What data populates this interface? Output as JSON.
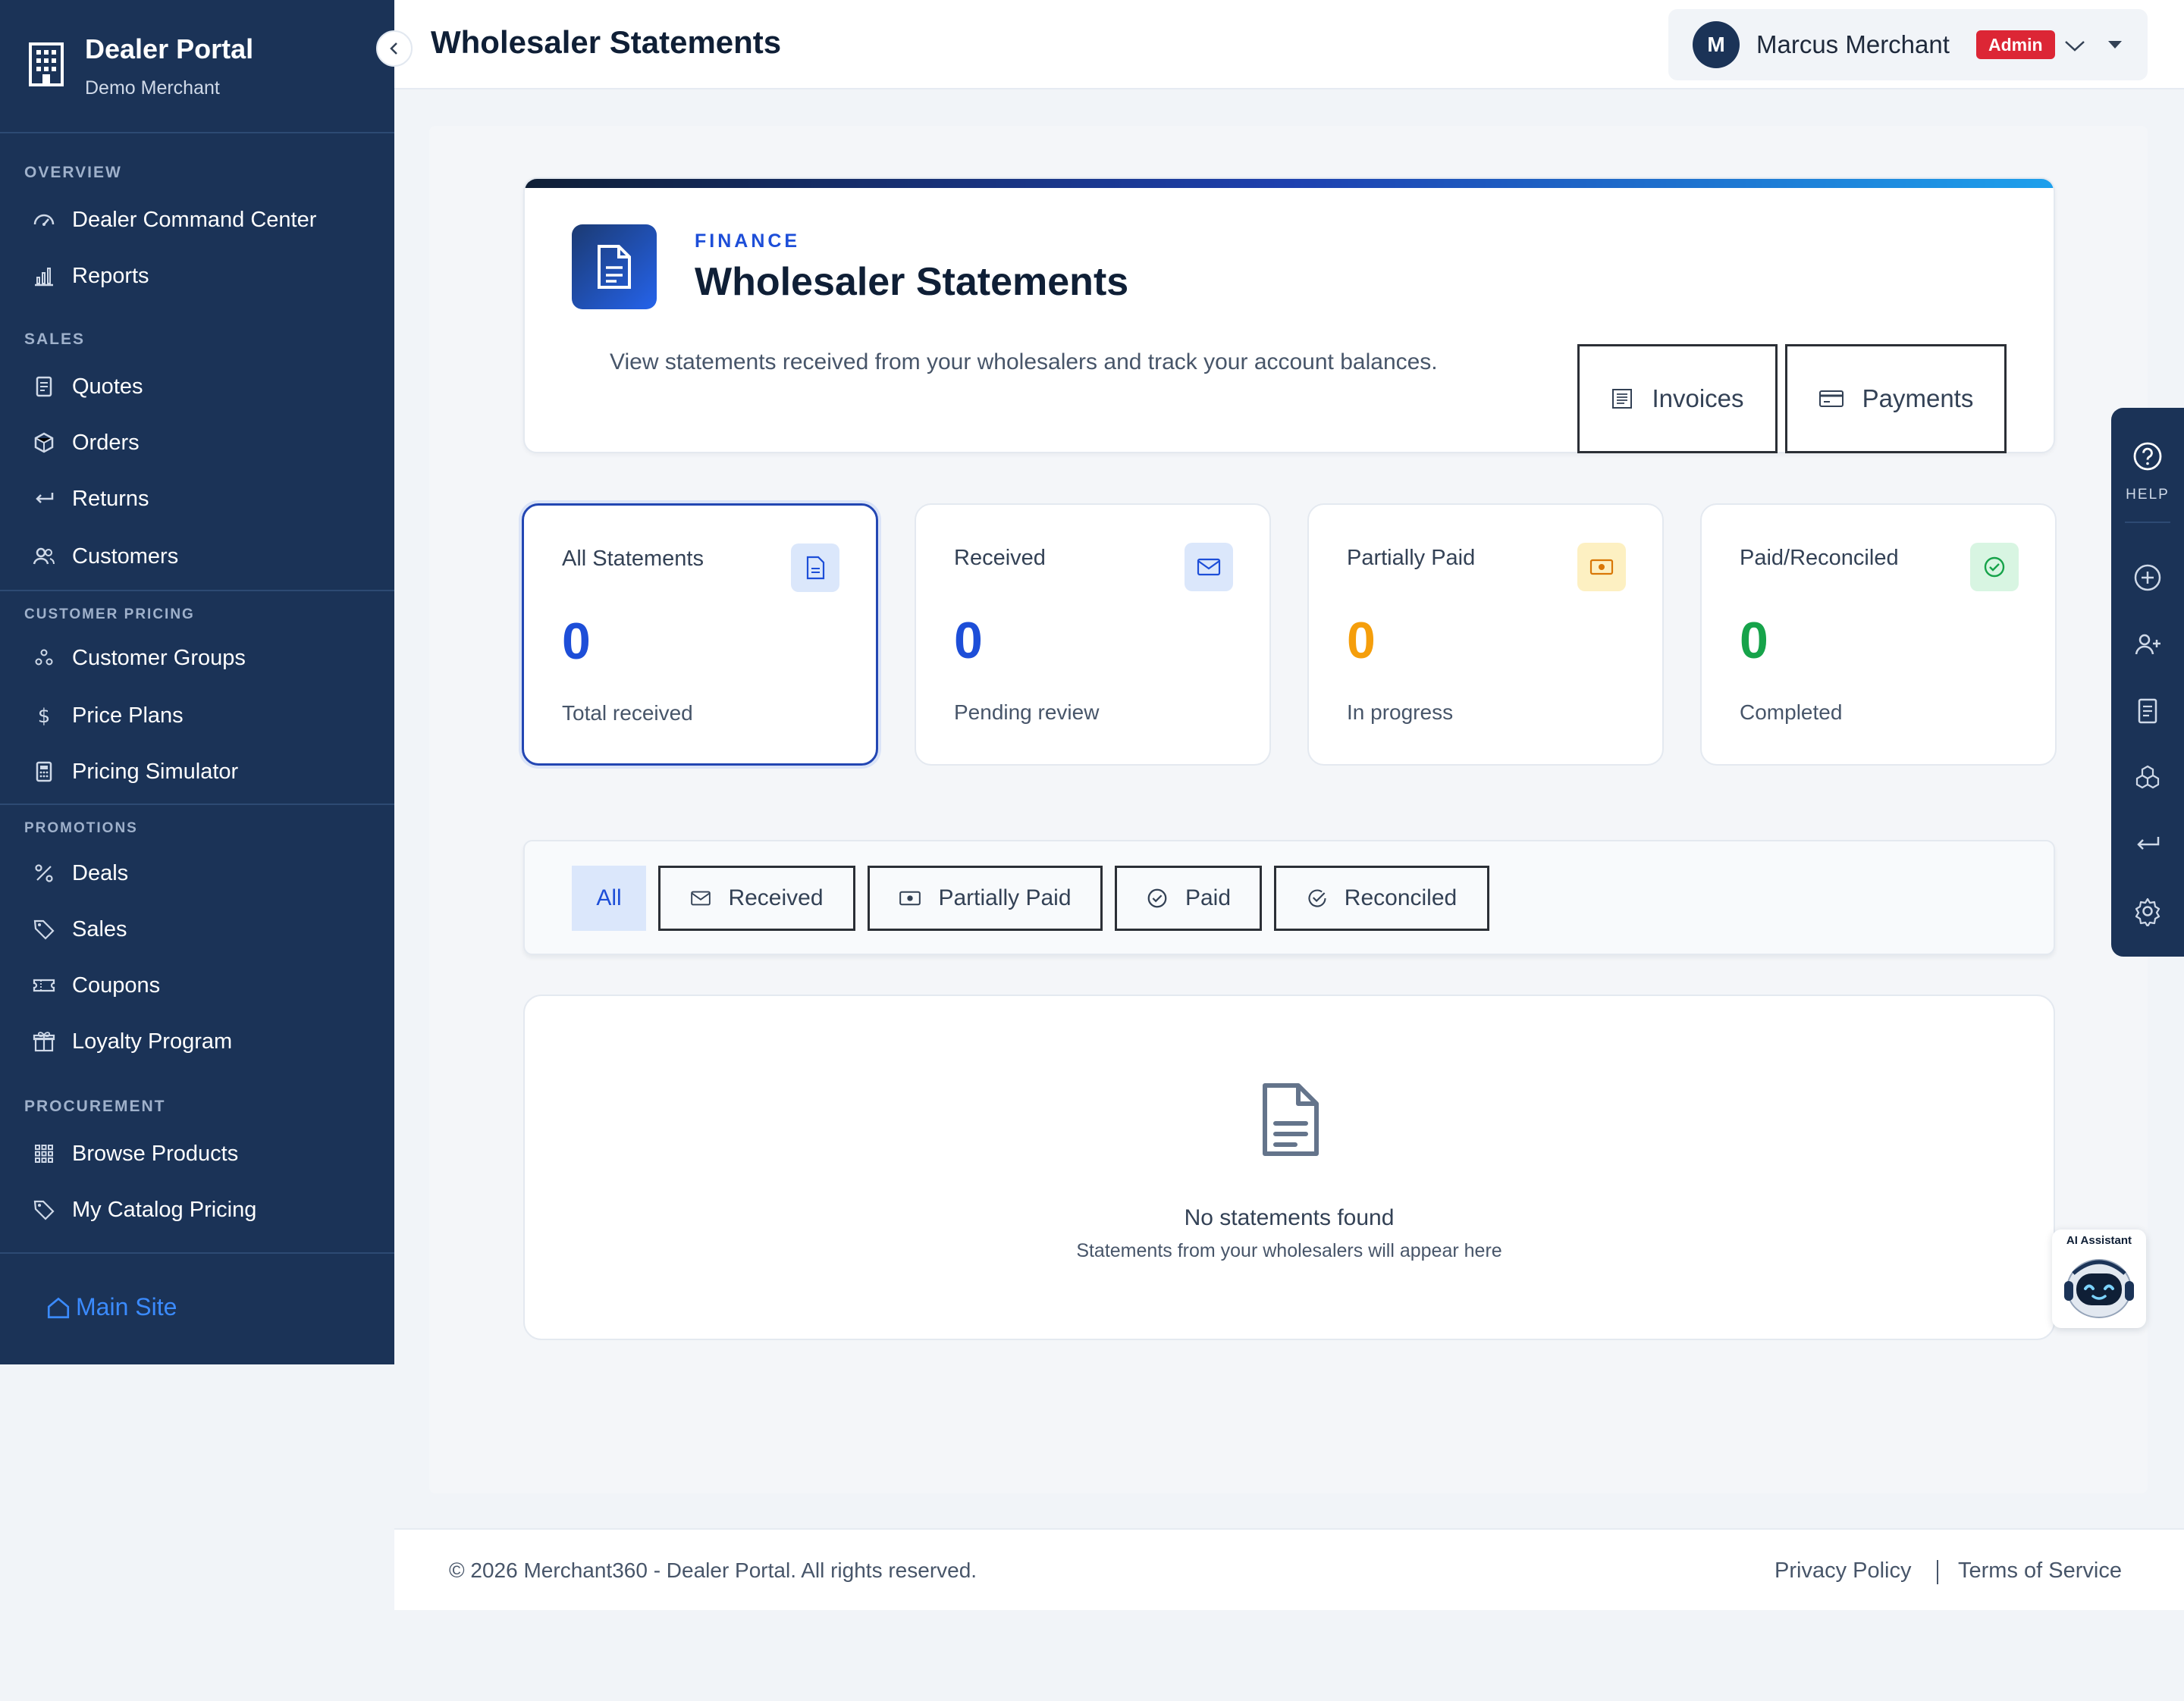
{
  "sidebar": {
    "brand_title": "Dealer Portal",
    "brand_sub": "Demo Merchant",
    "sections": {
      "overview": "OVERVIEW",
      "sales": "SALES",
      "customer_pricing": "CUSTOMER PRICING",
      "promotions": "PROMOTIONS",
      "procurement": "PROCUREMENT"
    },
    "items": {
      "command_center": "Dealer Command Center",
      "reports": "Reports",
      "quotes": "Quotes",
      "orders": "Orders",
      "returns": "Returns",
      "customers": "Customers",
      "customer_groups": "Customer Groups",
      "price_plans": "Price Plans",
      "pricing_simulator": "Pricing Simulator",
      "deals": "Deals",
      "sales": "Sales",
      "coupons": "Coupons",
      "loyalty_program": "Loyalty Program",
      "browse_products": "Browse Products",
      "my_catalog_pricing": "My Catalog Pricing"
    },
    "main_site": "Main Site"
  },
  "header": {
    "title": "Wholesaler Statements",
    "user_initial": "M",
    "user_name": "Marcus Merchant",
    "role_badge": "Admin"
  },
  "hero": {
    "kicker": "FINANCE",
    "title": "Wholesaler Statements",
    "description": "View statements received from your wholesalers and track your account balances.",
    "invoices_label": "Invoices",
    "payments_label": "Payments"
  },
  "stats": [
    {
      "label": "All Statements",
      "value": "0",
      "sub": "Total received",
      "color": "#1d4ed8",
      "icon": "document-icon"
    },
    {
      "label": "Received",
      "value": "0",
      "sub": "Pending review",
      "color": "#1d4ed8",
      "icon": "envelope-icon"
    },
    {
      "label": "Partially Paid",
      "value": "0",
      "sub": "In progress",
      "color": "#f59e0b",
      "icon": "cash-icon"
    },
    {
      "label": "Paid/Reconciled",
      "value": "0",
      "sub": "Completed",
      "color": "#16a34a",
      "icon": "check-circle-icon"
    }
  ],
  "filters": {
    "all": "All",
    "received": "Received",
    "partially_paid": "Partially Paid",
    "paid": "Paid",
    "reconciled": "Reconciled"
  },
  "empty_state": {
    "title": "No statements found",
    "subtitle": "Statements from your wholesalers will appear here"
  },
  "footer": {
    "copyright": "© 2026 Merchant360 - Dealer Portal. All rights reserved.",
    "privacy": "Privacy Policy",
    "terms": "Terms of Service"
  },
  "help_rail": {
    "help_label": "HELP"
  },
  "ai_assistant": {
    "label": "AI Assistant"
  },
  "colors": {
    "sidebar_bg": "#1b3357",
    "accent": "#1d4ed8",
    "admin_badge": "#dc2635",
    "warning": "#f59e0b",
    "success": "#16a34a"
  }
}
